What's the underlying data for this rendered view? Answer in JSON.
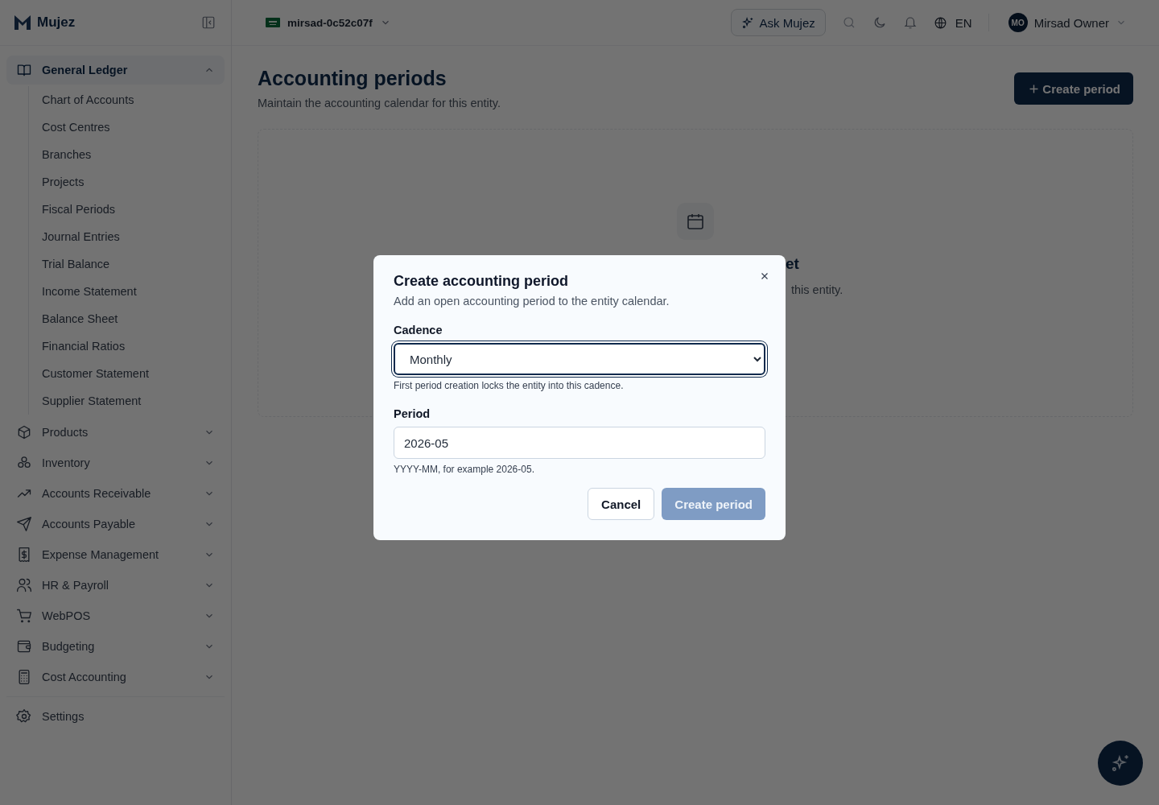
{
  "brand": {
    "name": "Mujez"
  },
  "entity": {
    "name": "mirsad-0c52c07f"
  },
  "topbar": {
    "ask_button": "Ask Mujez",
    "language": "EN",
    "avatar": "MO",
    "user": "Mirsad Owner"
  },
  "sidebar": {
    "items": [
      {
        "kind": "group",
        "label": "General Ledger",
        "expanded": true,
        "children": [
          {
            "label": "Chart of Accounts"
          },
          {
            "label": "Cost Centres"
          },
          {
            "label": "Branches"
          },
          {
            "label": "Projects"
          },
          {
            "label": "Fiscal Periods"
          },
          {
            "label": "Journal Entries"
          },
          {
            "label": "Trial Balance"
          },
          {
            "label": "Income Statement"
          },
          {
            "label": "Balance Sheet"
          },
          {
            "label": "Financial Ratios"
          },
          {
            "label": "Customer Statement"
          },
          {
            "label": "Supplier Statement"
          }
        ]
      },
      {
        "kind": "group",
        "label": "Products",
        "expanded": false
      },
      {
        "kind": "group",
        "label": "Inventory",
        "expanded": false
      },
      {
        "kind": "group",
        "label": "Accounts Receivable",
        "expanded": false
      },
      {
        "kind": "group",
        "label": "Accounts Payable",
        "expanded": false
      },
      {
        "kind": "group",
        "label": "Expense Management",
        "expanded": false
      },
      {
        "kind": "group",
        "label": "HR & Payroll",
        "expanded": false
      },
      {
        "kind": "group",
        "label": "WebPOS",
        "expanded": false
      },
      {
        "kind": "group",
        "label": "Budgeting",
        "expanded": false
      },
      {
        "kind": "group",
        "label": "Cost Accounting",
        "expanded": false
      },
      {
        "kind": "link",
        "label": "Settings"
      }
    ]
  },
  "page": {
    "title": "Accounting periods",
    "subtitle": "Maintain the accounting calendar for this entity.",
    "create_button": "Create period",
    "empty_title_fragment": "et",
    "empty_text_fragment": "this entity."
  },
  "dialog": {
    "title": "Create accounting period",
    "subtitle": "Add an open accounting period to the entity calendar.",
    "fields": [
      {
        "label": "Cadence",
        "kind": "select",
        "value": "Monthly",
        "focused": true,
        "hint": "First period creation locks the entity into this cadence."
      },
      {
        "label": "Period",
        "kind": "input",
        "value": "2026-05",
        "focused": false,
        "hint": "YYYY-MM, for example 2026-05."
      }
    ],
    "cancel": "Cancel",
    "submit": {
      "label": "Create period",
      "disabled": true
    }
  }
}
